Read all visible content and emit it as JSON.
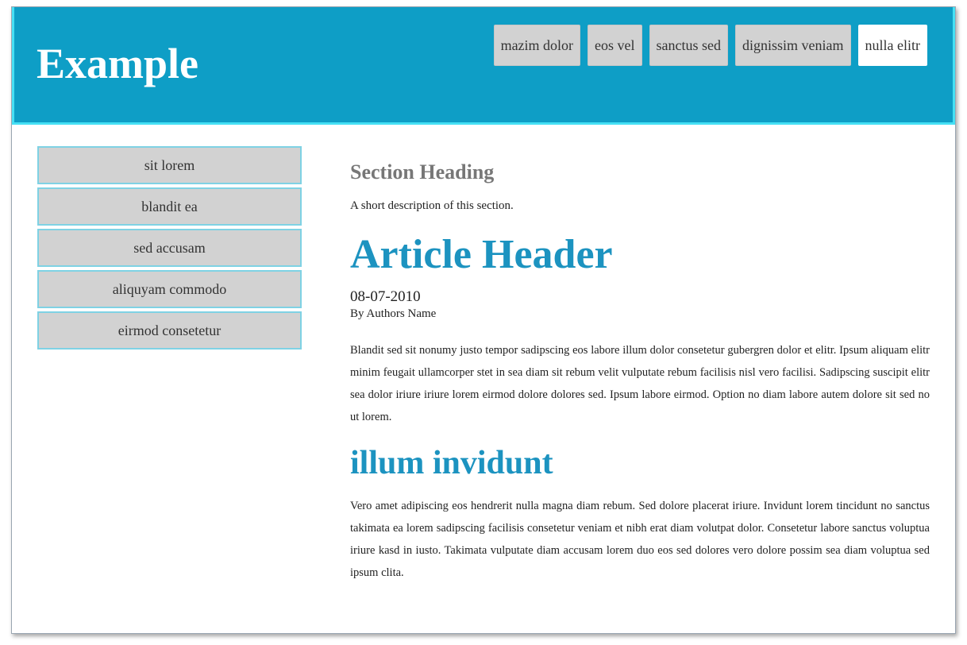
{
  "header": {
    "logo": "Example",
    "nav": [
      {
        "label": "mazim dolor"
      },
      {
        "label": "eos vel"
      },
      {
        "label": "sanctus sed"
      },
      {
        "label": "dignissim veniam"
      },
      {
        "label": "nulla elitr"
      }
    ],
    "active_tab": "nulla elitr"
  },
  "sidebar": {
    "items": [
      {
        "label": "sit lorem"
      },
      {
        "label": "blandit ea"
      },
      {
        "label": "sed accusam"
      },
      {
        "label": "aliquyam commodo"
      },
      {
        "label": "eirmod consetetur"
      }
    ]
  },
  "main": {
    "section_heading": "Section Heading",
    "section_description": "A short description of this section.",
    "article": {
      "header": "Article Header",
      "date": "08-07-2010",
      "author": "By Authors Name",
      "paragraph1": "Blandit sed sit nonumy justo tempor sadipscing eos labore illum dolor consetetur gubergren dolor et elitr. Ipsum aliquam elitr minim feugait ullamcorper stet in sea diam sit rebum velit vulputate rebum facilisis nisl vero facilisi. Sadipscing suscipit elitr sea dolor iriure iriure lorem eirmod dolore dolores sed. Ipsum labore eirmod. Option no diam labore autem dolore sit sed no ut lorem.",
      "subheading": "illum invidunt",
      "paragraph2": "Vero amet adipiscing eos hendrerit nulla magna diam rebum. Sed dolore placerat iriure. Invidunt lorem tincidunt no sanctus takimata ea lorem sadipscing facilisis consetetur veniam et nibh erat diam volutpat dolor. Consetetur labore sanctus voluptua iriure kasd in iusto. Takimata vulputate diam accusam lorem duo eos sed dolores vero dolore possim sea diam voluptua sed ipsum clita."
    }
  },
  "colors": {
    "header_bg": "#0e9ec6",
    "header_border": "#46e0f4",
    "accent": "#1c93c0",
    "tab_bg": "#d2d2d2",
    "active_tab_bg": "#ffffff",
    "sidebar_border": "#7fd2e4"
  }
}
